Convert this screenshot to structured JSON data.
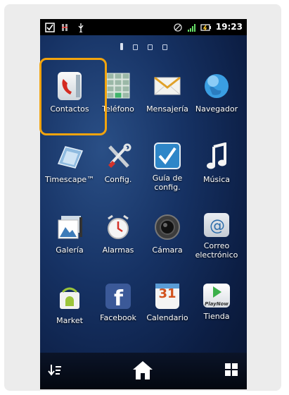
{
  "status_bar": {
    "time": "19:23"
  },
  "home_screen": {
    "active_page": 1,
    "page_count": 4,
    "apps": [
      {
        "label": "Contactos",
        "icon": "contacts-icon",
        "highlighted": true
      },
      {
        "label": "Teléfono",
        "icon": "phone-dialer-icon"
      },
      {
        "label": "Mensajería",
        "icon": "messaging-envelope-icon"
      },
      {
        "label": "Navegador",
        "icon": "browser-globe-icon"
      },
      {
        "label": "Timescape™",
        "icon": "timescape-icon"
      },
      {
        "label": "Config.",
        "icon": "settings-tools-icon"
      },
      {
        "label": "Guía de config.",
        "icon": "setup-guide-checkbox-icon"
      },
      {
        "label": "Música",
        "icon": "music-note-icon"
      },
      {
        "label": "Galería",
        "icon": "gallery-icon"
      },
      {
        "label": "Alarmas",
        "icon": "alarm-clock-icon"
      },
      {
        "label": "Cámara",
        "icon": "camera-icon"
      },
      {
        "label": "Correo electrónico",
        "icon": "email-at-icon"
      },
      {
        "label": "Market",
        "icon": "android-market-icon"
      },
      {
        "label": "Facebook",
        "icon": "facebook-icon"
      },
      {
        "label": "Calendario",
        "icon": "calendar-icon"
      },
      {
        "label": "Tienda",
        "icon": "playnow-store-icon"
      }
    ],
    "calendar_day": "31",
    "playnow_text": "PlayNow"
  },
  "dock": {
    "left_icon": "sort-list-icon",
    "center_icon": "home-icon",
    "right_icon": "app-grid-icon"
  }
}
